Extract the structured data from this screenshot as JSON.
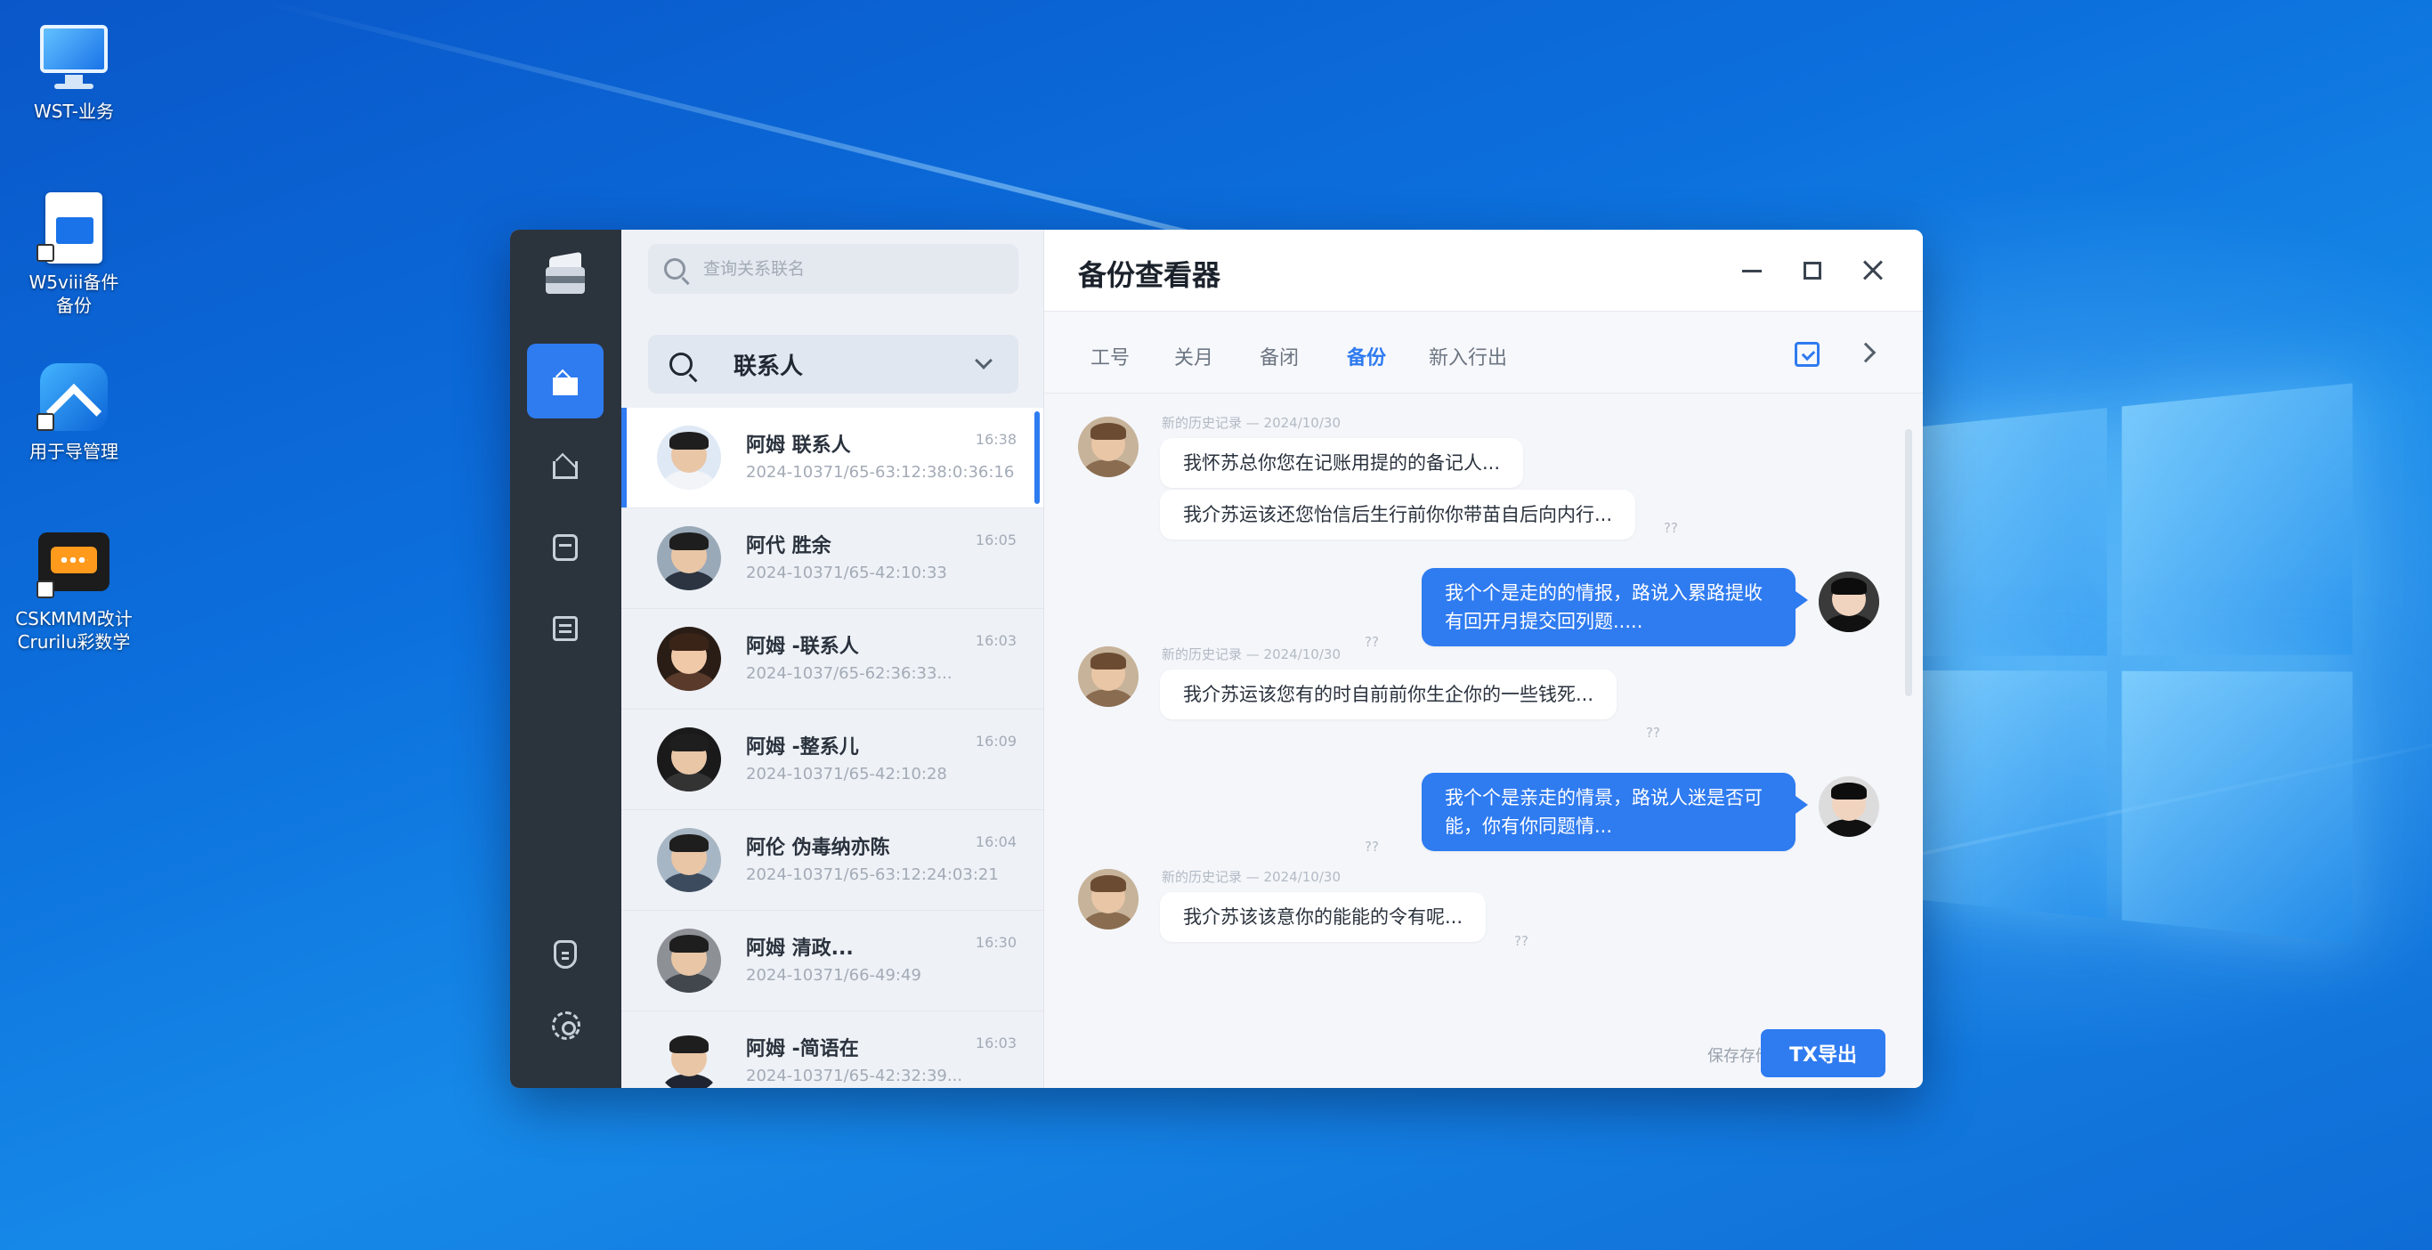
{
  "desktop": {
    "icons": [
      {
        "label_line1": "WST-业务",
        "label_line2": ""
      },
      {
        "label_line1": "W5viii备件",
        "label_line2": "备份"
      },
      {
        "label_line1": "用于导管理",
        "label_line2": ""
      },
      {
        "label_line1": "CSKMMM改计",
        "label_line2": "Crurilu彩数学"
      }
    ]
  },
  "window": {
    "title": "备份查看器",
    "rail": {
      "items": [
        "home",
        "home-outline",
        "box",
        "list",
        "shield",
        "settings"
      ]
    },
    "search": {
      "placeholder": "查询关系联名"
    },
    "filter": {
      "label": "联系人"
    },
    "contacts": [
      {
        "name": "阿姆 联系人",
        "sub": "2024-10371/65-63:12:38:0:36:16",
        "time": "16:38"
      },
      {
        "name": "阿代 胜余",
        "sub": "2024-10371/65-42:10:33",
        "time": "16:05"
      },
      {
        "name": "阿姆 -联系人",
        "sub": "2024-1037/65-62:36:33...",
        "time": "16:03"
      },
      {
        "name": "阿姆 -整系儿",
        "sub": "2024-10371/65-42:10:28",
        "time": "16:09"
      },
      {
        "name": "阿伦 伪毒纳亦陈",
        "sub": "2024-10371/65-63:12:24:03:21",
        "time": "16:04"
      },
      {
        "name": "阿姆 清政...",
        "sub": "2024-10371/66-49:49",
        "time": "16:30"
      },
      {
        "name": "阿姆 -简语在",
        "sub": "2024-10371/65-42:32:39...",
        "time": "16:03"
      }
    ],
    "tabs": [
      {
        "label": "工号"
      },
      {
        "label": "关月"
      },
      {
        "label": "备闭"
      },
      {
        "label": "备份"
      },
      {
        "label": "新入行出"
      }
    ],
    "active_tab": "备份",
    "messages": [
      {
        "meta": "新的历史记录 — 2024/10/30",
        "lines": [
          "我怀苏总你您在记账用提的的备记人...",
          "我介苏运该还您怡信后生行前你你带苗自后向内行..."
        ],
        "tick": "??"
      },
      {
        "text": "我个个是走的的情报，路说入累路提收有回开月提交回列题.....",
        "tick": "??"
      },
      {
        "meta": "新的历史记录 — 2024/10/30",
        "lines": [
          "我介苏运该您有的时自前前你生企你的一些钱死..."
        ],
        "tick": "??"
      },
      {
        "text": "我个个是亲走的情景，路说人迷是否可能，你有你同题情...",
        "tick": "??"
      },
      {
        "meta": "新的历史记录 — 2024/10/30",
        "lines": [
          "我介苏该该意你的能能的令有呢..."
        ],
        "tick": "??"
      }
    ],
    "footer": {
      "status": "保存存储",
      "export_label": "TX导出"
    }
  },
  "colors": {
    "accent": "#2f7bf0",
    "rail": "#2b333d"
  }
}
